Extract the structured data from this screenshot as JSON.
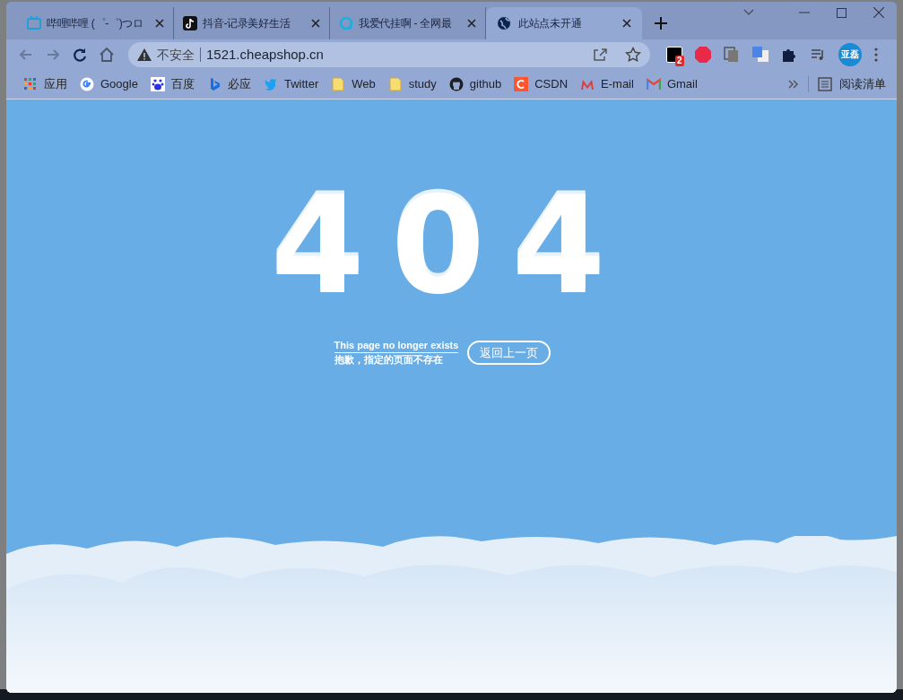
{
  "tabs": [
    {
      "title": "哔哩哔哩 (゜-゜)つロ",
      "selected": false
    },
    {
      "title": "抖音-记录美好生活",
      "selected": false
    },
    {
      "title": "我爱代挂啊 - 全网最",
      "selected": false
    },
    {
      "title": "此站点未开通",
      "selected": true
    }
  ],
  "address_bar": {
    "security": "不安全",
    "url": "1521.cheapshop.cn"
  },
  "extension_badge": "2",
  "profile": "亚磊",
  "bookmarks": [
    {
      "label": "应用"
    },
    {
      "label": "Google"
    },
    {
      "label": "百度"
    },
    {
      "label": "必应"
    },
    {
      "label": "Twitter"
    },
    {
      "label": "Web"
    },
    {
      "label": "study"
    },
    {
      "label": "github"
    },
    {
      "label": "CSDN"
    },
    {
      "label": "E-mail"
    },
    {
      "label": "Gmail"
    }
  ],
  "reading_list": "阅读清单",
  "page": {
    "code": "404",
    "message_en": "This page no longer exists",
    "message_zh": "抱歉，指定的页面不存在",
    "back_button": "返回上一页"
  }
}
